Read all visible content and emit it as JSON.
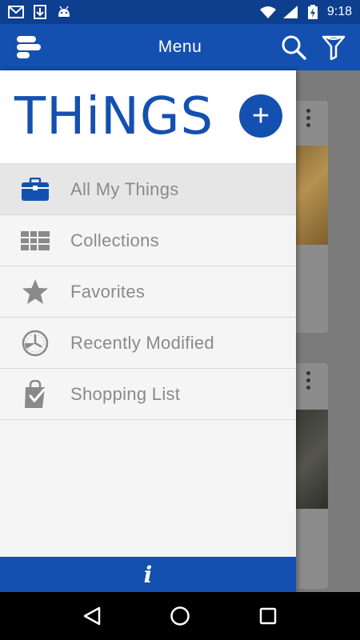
{
  "status_bar": {
    "time": "9:18",
    "left_icons": [
      "gmail-icon",
      "download-icon",
      "android-icon"
    ],
    "right_icons": [
      "wifi-icon",
      "signal-icon",
      "battery-charging-icon"
    ]
  },
  "app_bar": {
    "title": "Menu",
    "left_icon": "app-logo-icon",
    "actions": [
      "search-icon",
      "filter-icon"
    ]
  },
  "drawer": {
    "brand": "THiNGS",
    "add_label": "+",
    "items": [
      {
        "label": "All My Things",
        "icon": "briefcase-icon",
        "active": true
      },
      {
        "label": "Collections",
        "icon": "grid-icon",
        "active": false
      },
      {
        "label": "Favorites",
        "icon": "star-icon",
        "active": false
      },
      {
        "label": "Recently Modified",
        "icon": "clock-icon",
        "active": false
      },
      {
        "label": "Shopping List",
        "icon": "shopping-bag-icon",
        "active": false
      }
    ],
    "footer_label": "i"
  },
  "nav_bar": {
    "buttons": [
      "back-icon",
      "home-icon",
      "recents-icon"
    ]
  },
  "colors": {
    "primary": "#1450b0",
    "status_bar": "#0e3f8f",
    "menu_text": "#8a8a8a"
  }
}
